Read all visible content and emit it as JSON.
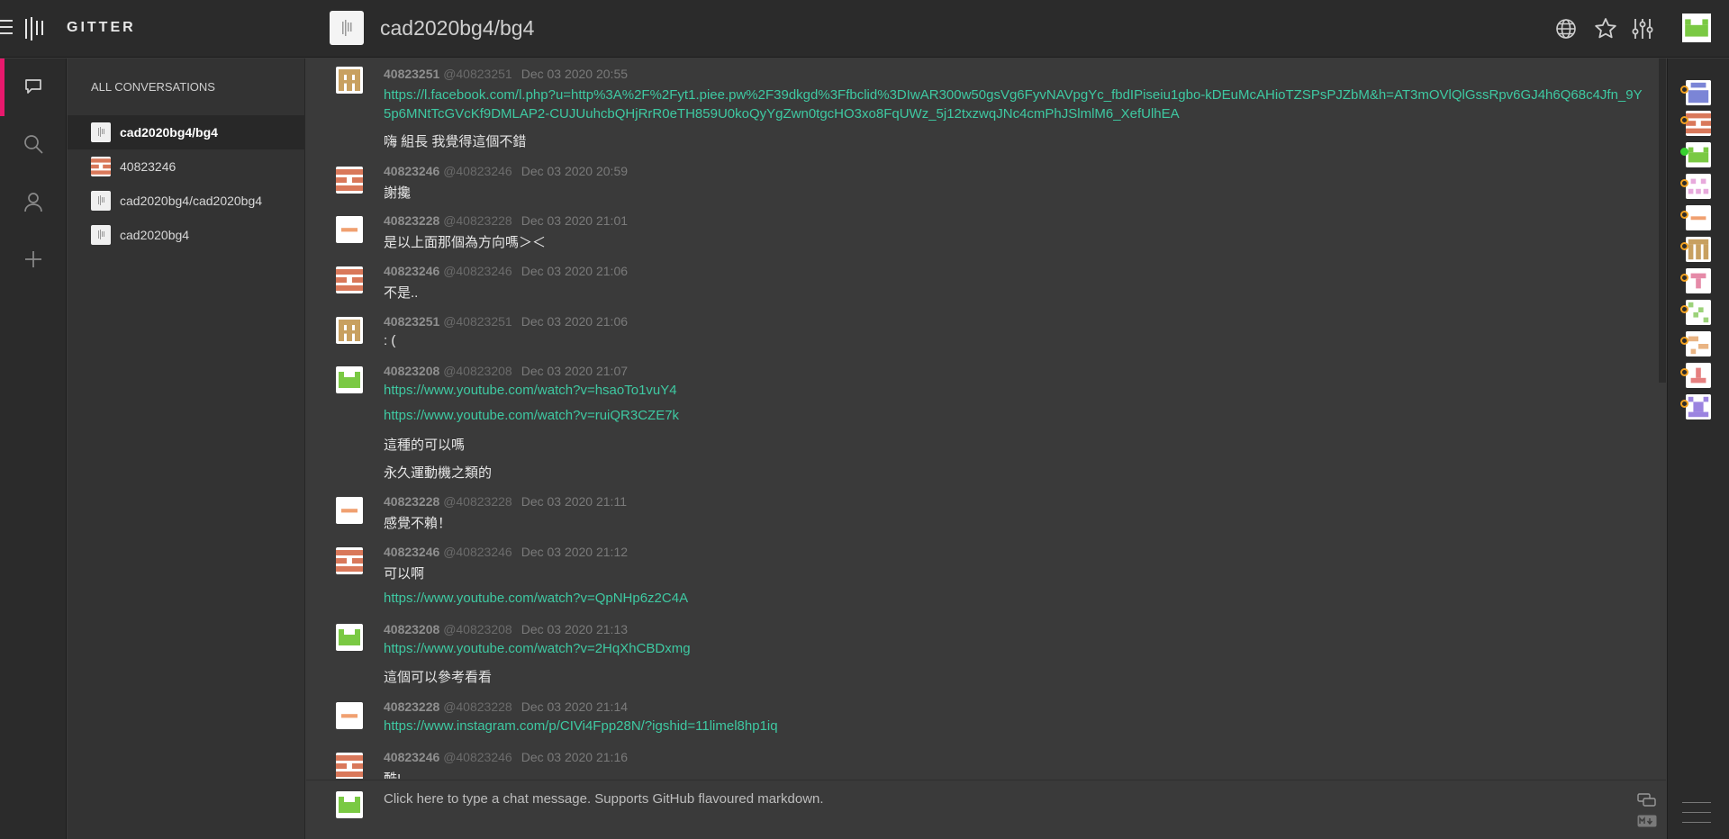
{
  "app": {
    "brand": "GITTER"
  },
  "header": {
    "room_title": "cad2020bg4/bg4",
    "icons": [
      "globe-icon",
      "star-icon",
      "settings-sliders-icon"
    ]
  },
  "leftnav": {
    "icons": [
      "chat-bubble-icon",
      "search-icon",
      "person-icon",
      "plus-icon"
    ]
  },
  "conversations": {
    "header": "ALL CONVERSATIONS",
    "items": [
      {
        "label": "cad2020bg4/bg4",
        "active": true
      },
      {
        "label": "40823246",
        "active": false
      },
      {
        "label": "cad2020bg4/cad2020bg4",
        "active": false
      },
      {
        "label": "cad2020bg4",
        "active": false
      }
    ]
  },
  "messages": [
    {
      "user": "40823251",
      "handle": "@40823251",
      "time": "Dec 03 2020 20:55",
      "lines": [
        "https://l.facebook.com/l.php?u=http%3A%2F%2Fyt1.piee.pw%2F39dkgd%3Ffbclid%3DIwAR300w50gsVg6FyvNAVpgYc_fbdIPiseiu1gbo-kDEuMcAHioTZSPsPJZbM&h=AT3mOVlQlGssRpv6GJ4h6Q68c4Jfn_9Y5p6MNtTcGVcKf9DMLAP2-CUJUuhcbQHjRrR0eTH859U0koQyYgZwn0tgcHO3xo8FqUWz_5j12txzwqJNc4cmPhJSlmlM6_XefUlhEA",
        "嗨 組長 我覺得這個不錯"
      ]
    },
    {
      "user": "40823246",
      "handle": "@40823246",
      "time": "Dec 03 2020 20:59",
      "lines": [
        "謝攙"
      ]
    },
    {
      "user": "40823228",
      "handle": "@40823228",
      "time": "Dec 03 2020 21:01",
      "lines": [
        "是以上面那個為方向嗎＞＜"
      ]
    },
    {
      "user": "40823246",
      "handle": "@40823246",
      "time": "Dec 03 2020 21:06",
      "lines": [
        "不是.."
      ]
    },
    {
      "user": "40823251",
      "handle": "@40823251",
      "time": "Dec 03 2020 21:06",
      "lines": [
        ": ("
      ]
    },
    {
      "user": "40823208",
      "handle": "@40823208",
      "time": "Dec 03 2020 21:07",
      "lines": [
        "https://www.youtube.com/watch?v=hsaoTo1vuY4",
        "https://www.youtube.com/watch?v=ruiQR3CZE7k",
        "這種的可以嗎",
        "永久運動機之類的"
      ]
    },
    {
      "user": "40823228",
      "handle": "@40823228",
      "time": "Dec 03 2020 21:11",
      "lines": [
        "感覺不賴！"
      ]
    },
    {
      "user": "40823246",
      "handle": "@40823246",
      "time": "Dec 03 2020 21:12",
      "lines": [
        "可以啊",
        "https://www.youtube.com/watch?v=QpNHp6z2C4A"
      ]
    },
    {
      "user": "40823208",
      "handle": "@40823208",
      "time": "Dec 03 2020 21:13",
      "lines": [
        "https://www.youtube.com/watch?v=2HqXhCBDxmg",
        "這個可以參考看看"
      ]
    },
    {
      "user": "40823228",
      "handle": "@40823228",
      "time": "Dec 03 2020 21:14",
      "lines": [
        "https://www.instagram.com/p/CIVi4Fpp28N/?igshid=11limel8hp1iq"
      ]
    },
    {
      "user": "40823246",
      "handle": "@40823246",
      "time": "Dec 03 2020 21:16",
      "lines": [
        "酷!"
      ]
    }
  ],
  "composer": {
    "placeholder": "Click here to type a chat message. Supports GitHub flavoured markdown."
  },
  "colors": {
    "accent": "#e8196d",
    "link": "#3ec9a2",
    "background": "#3a3a3a",
    "sidebar": "#2b2b2b"
  }
}
